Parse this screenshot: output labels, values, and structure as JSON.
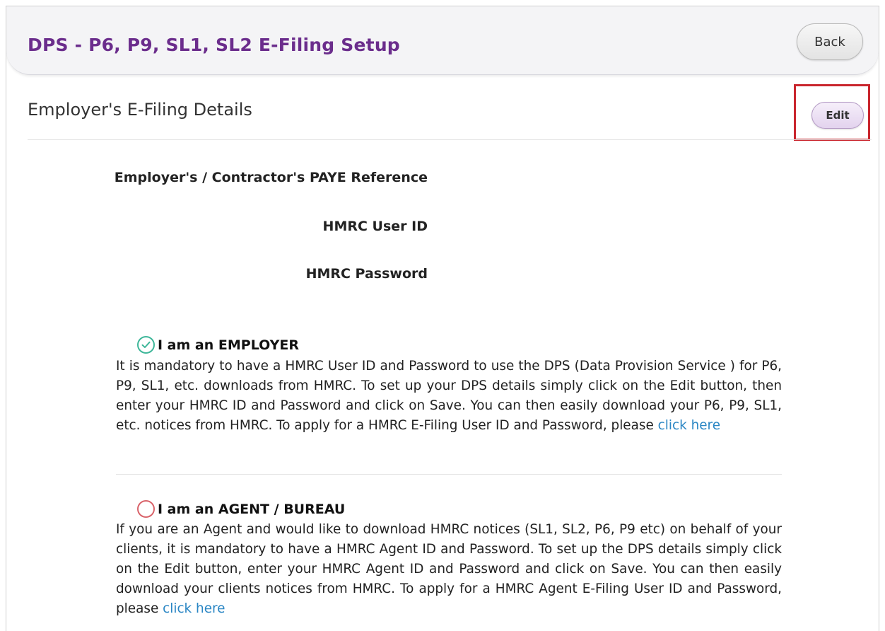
{
  "header": {
    "title": "DPS - P6, P9, SL1, SL2 E-Filing Setup",
    "back_label": "Back"
  },
  "section": {
    "heading": "Employer's E-Filing Details",
    "edit_label": "Edit"
  },
  "fields": {
    "paye_reference_label": "Employer's / Contractor's PAYE Reference",
    "user_id_label": "HMRC User ID",
    "password_label": "HMRC Password"
  },
  "options": {
    "employer": {
      "label": "I am an EMPLOYER",
      "selected": true,
      "text": "It is mandatory to have a HMRC User ID and Password to use the DPS (Data Provision Service ) for P6, P9, SL1, etc. downloads from HMRC. To set up your DPS details simply click on the Edit button, then enter your HMRC ID and Password and click on Save. You can then easily download your P6, P9, SL1, etc. notices from HMRC. To apply for a HMRC E-Filing User ID and Password, please ",
      "link_text": "click here"
    },
    "agent": {
      "label": "I am an AGENT / BUREAU",
      "selected": false,
      "text": "If you are an Agent and would like to download HMRC notices (SL1, SL2, P6, P9 etc) on behalf of your clients, it is mandatory to have a HMRC Agent ID and Password. To set up the DPS details simply click on the Edit button, enter your HMRC Agent ID and Password and click on Save. You can then easily download your clients notices from HMRC. To apply for a HMRC Agent E-Filing User ID and Password, please ",
      "link_text": "click here"
    }
  },
  "colors": {
    "title": "#6b2d8c",
    "link": "#2a86c4",
    "check_green": "#3fb79a",
    "radio_red": "#d9646b",
    "highlight_red": "#c9252d"
  },
  "icons": {
    "employer_radio": "check-circle-icon",
    "agent_radio": "empty-circle-icon"
  }
}
